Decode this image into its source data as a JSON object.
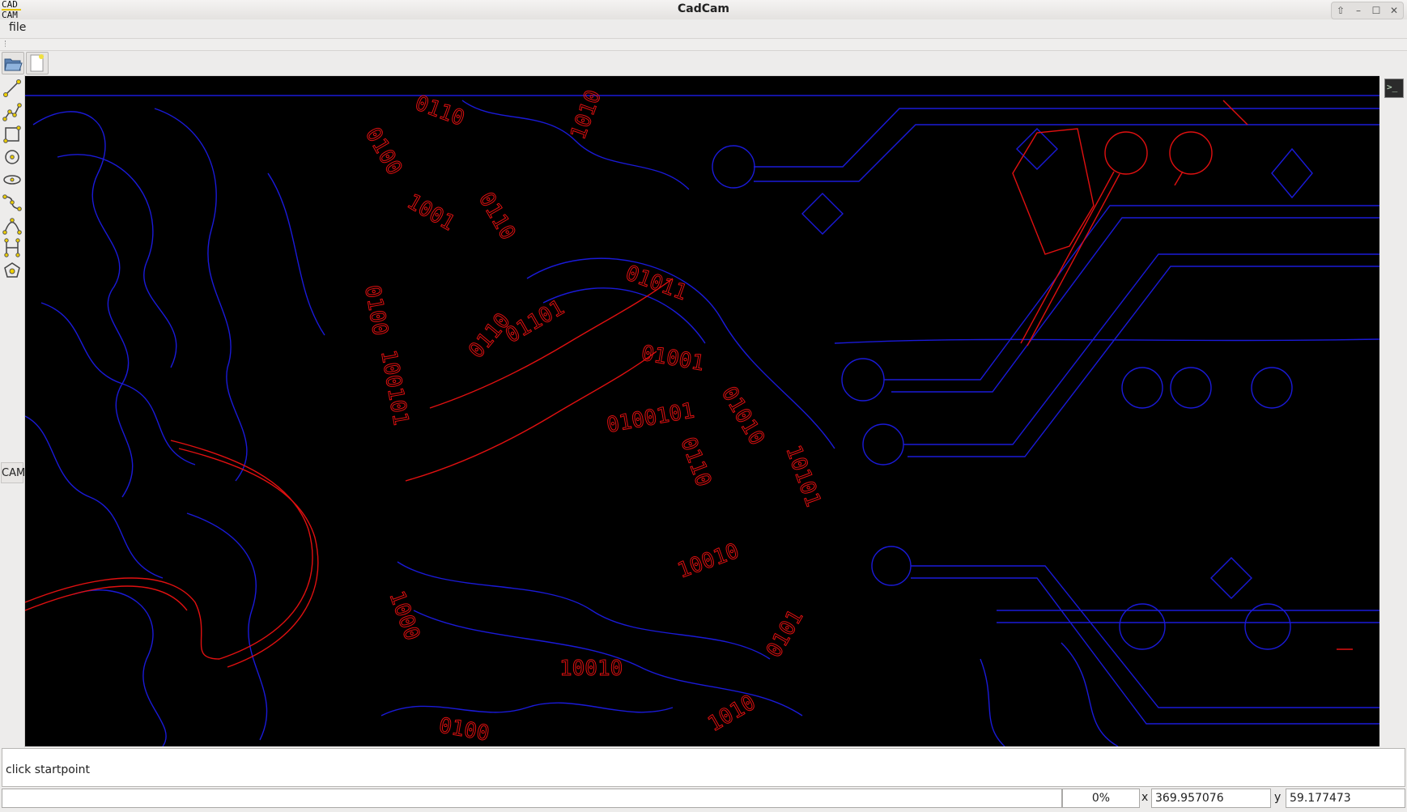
{
  "window": {
    "title": "CadCam",
    "logo_top": "CAD",
    "logo_bottom": "CAM"
  },
  "menu": {
    "file_label": "file"
  },
  "toolbar": {
    "buttons": [
      "open-file",
      "new-file"
    ]
  },
  "left_tools": [
    "line",
    "polyline",
    "rectangle",
    "circle",
    "ellipse",
    "spline",
    "arc",
    "measure",
    "polygon"
  ],
  "cam_label": "CAM",
  "message": "click startpoint",
  "status": {
    "progress": "0%",
    "x_label": "x",
    "x_value": "369.957076",
    "y_label": "y",
    "y_value": "59.177473"
  },
  "colors": {
    "canvas_bg": "#000000",
    "contour_blue": "#1a1ad8",
    "contour_red": "#e01010"
  }
}
